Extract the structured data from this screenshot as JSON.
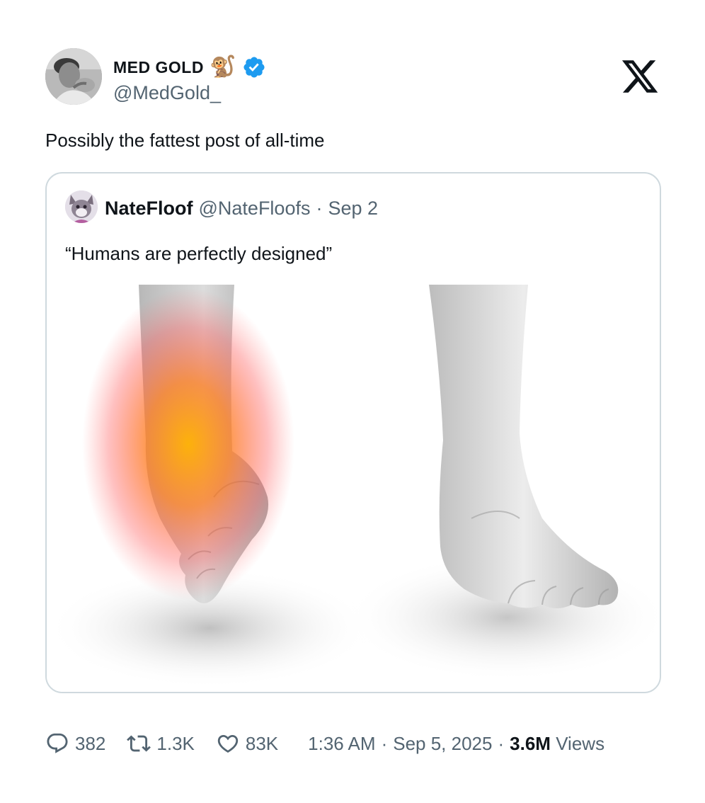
{
  "author": {
    "display_name": "MED GOLD",
    "name_emoji": "🐒",
    "handle": "@MedGold_",
    "verified": true,
    "avatar_icon": "profile-photo"
  },
  "brand": {
    "logo_icon": "x-logo"
  },
  "tweet": {
    "text": "Possibly the fattest post of all-time"
  },
  "quoted_tweet": {
    "display_name": "NateFloof",
    "handle": "@NateFloofs",
    "separator": "·",
    "date": "Sep 2",
    "text": "“Humans are perfectly designed”",
    "image_icon": "feet-comparison-illustration"
  },
  "stats": {
    "replies": "382",
    "reposts": "1.3K",
    "likes": "83K",
    "time": "1:36 AM",
    "separator": "·",
    "date": "Sep 5, 2025",
    "views_count": "3.6M",
    "views_label": "Views"
  },
  "colors": {
    "text_primary": "#0f1419",
    "text_secondary": "#536471",
    "verified_blue": "#1d9bf0",
    "border": "#cfd9de",
    "pain_highlight": "#ff8a00"
  }
}
